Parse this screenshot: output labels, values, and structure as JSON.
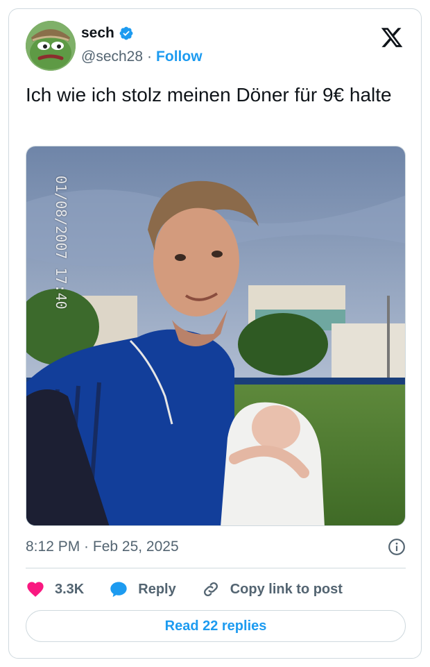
{
  "author": {
    "display_name": "sech",
    "handle": "@sech28",
    "separator": "·",
    "follow_label": "Follow",
    "verified": true
  },
  "tweet": {
    "text": "Ich wie ich stolz meinen Döner für 9€ halte",
    "photo_overlay_timestamp": "01/08/2007 17:40",
    "time": "8:12 PM · Feb 25, 2025"
  },
  "actions": {
    "likes": "3.3K",
    "reply_label": "Reply",
    "copy_link_label": "Copy link to post"
  },
  "read_replies_label": "Read 22 replies",
  "colors": {
    "brand": "#1d9bf0",
    "like": "#f91880",
    "muted": "#536471",
    "border": "#cfd9de"
  },
  "icons": [
    "verified-badge-icon",
    "x-logo-icon",
    "info-icon",
    "heart-icon",
    "reply-bubble-icon",
    "link-icon"
  ]
}
